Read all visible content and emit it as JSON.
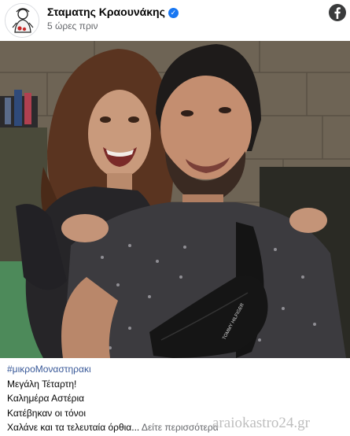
{
  "post": {
    "author": "Σταματης Κραουνάκης",
    "timestamp": "5 ώρες πριν",
    "verified": true,
    "platform_icon": "facebook-icon"
  },
  "photo": {
    "description_icon": "post-photo",
    "shirt_print": "TOMMY HILFIGER"
  },
  "caption": {
    "hashtag": "#μικροΜοναστηρακι",
    "lines": [
      "Μεγάλη Τέταρτη!",
      "Καλημέρα Αστέρια",
      "Κατέβηκαν οι τόνοι",
      "Χαλάνε και τα τελευταία όρθια..."
    ],
    "see_more": "Δείτε περισσότερα"
  },
  "watermark": "araiokastro24.gr",
  "colors": {
    "link": "#385898",
    "muted": "#65676b",
    "verified_badge": "#1877f2"
  }
}
